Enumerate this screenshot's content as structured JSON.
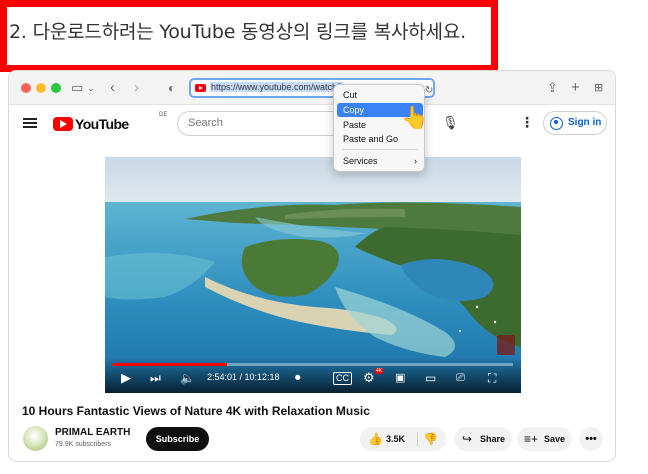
{
  "instruction": "2. 다운로드하려는 YouTube 동영상의 링크를 복사하세요.",
  "browser": {
    "url": "https://www.youtube.com/watch?"
  },
  "context_menu": {
    "items": [
      "Cut",
      "Copy",
      "Paste",
      "Paste and Go",
      "Services"
    ],
    "selected": "Copy"
  },
  "youtube": {
    "logo_text": "YouTube",
    "region": "DE",
    "search_placeholder": "Search",
    "sign_in": "Sign in"
  },
  "player": {
    "current_time": "2:54:01",
    "duration": "10:12:18",
    "time_display": "2:54:01 / 10:12:18",
    "progress_fraction": 0.284,
    "badge": "4K"
  },
  "video": {
    "title": "10 Hours Fantastic Views of Nature 4K with Relaxation Music",
    "channel": "PRIMAL EARTH",
    "subscribers": "79.9K subscribers",
    "subscribe_label": "Subscribe",
    "likes": "3.5K",
    "share_label": "Share",
    "save_label": "Save"
  },
  "colors": {
    "accent": "#ff0000",
    "highlight": "#3b82f6",
    "link": "#065fd4"
  },
  "icons": [
    "hamburger-icon",
    "mic-icon",
    "play-icon",
    "next-icon",
    "volume-icon",
    "settings-icon",
    "fullscreen-icon"
  ]
}
